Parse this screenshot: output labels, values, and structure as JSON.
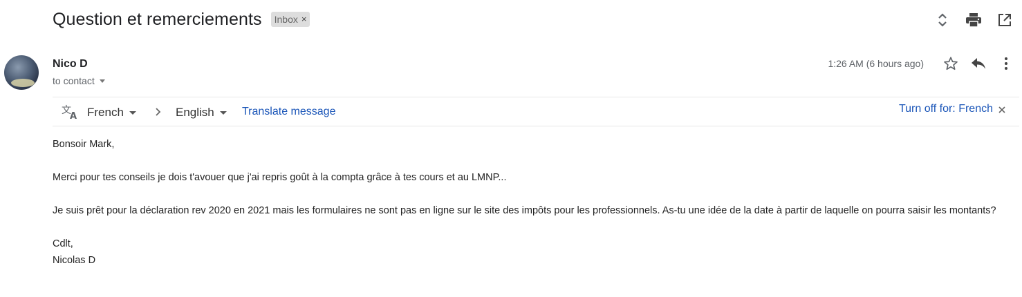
{
  "email": {
    "subject": "Question et remerciements",
    "label": "Inbox",
    "label_remove": "×",
    "sender": "Nico D",
    "recipient": "to contact",
    "timestamp": "1:26 AM (6 hours ago)"
  },
  "icons": {
    "expand": "unfold-more-icon",
    "print": "print-icon",
    "open_new_window": "open-in-new-icon",
    "star": "star-outline-icon",
    "reply": "reply-icon",
    "more": "more-vert-icon",
    "translate": "translate-icon",
    "chevron": "chevron-right-icon",
    "close": "close-icon"
  },
  "translate_bar": {
    "source_language": "French",
    "target_language": "English",
    "action": "Translate message",
    "turn_off": "Turn off for: French"
  },
  "body": {
    "greeting": "Bonsoir Mark,",
    "paragraph1": "Merci pour tes conseils je dois t'avouer que j'ai repris goût à la compta grâce à tes cours et au LMNP...",
    "paragraph2": "Je suis prêt pour la déclaration rev 2020 en 2021 mais les formulaires ne sont pas en ligne sur le site des impôts pour les professionnels. As-tu une idée de la date à partir de laquelle on pourra saisir les montants?",
    "signoff": "Cdlt,",
    "signature": "Nicolas D"
  },
  "colors": {
    "link": "#1a55b8",
    "icon": "#5f6368",
    "chip_bg": "#dddddd"
  }
}
